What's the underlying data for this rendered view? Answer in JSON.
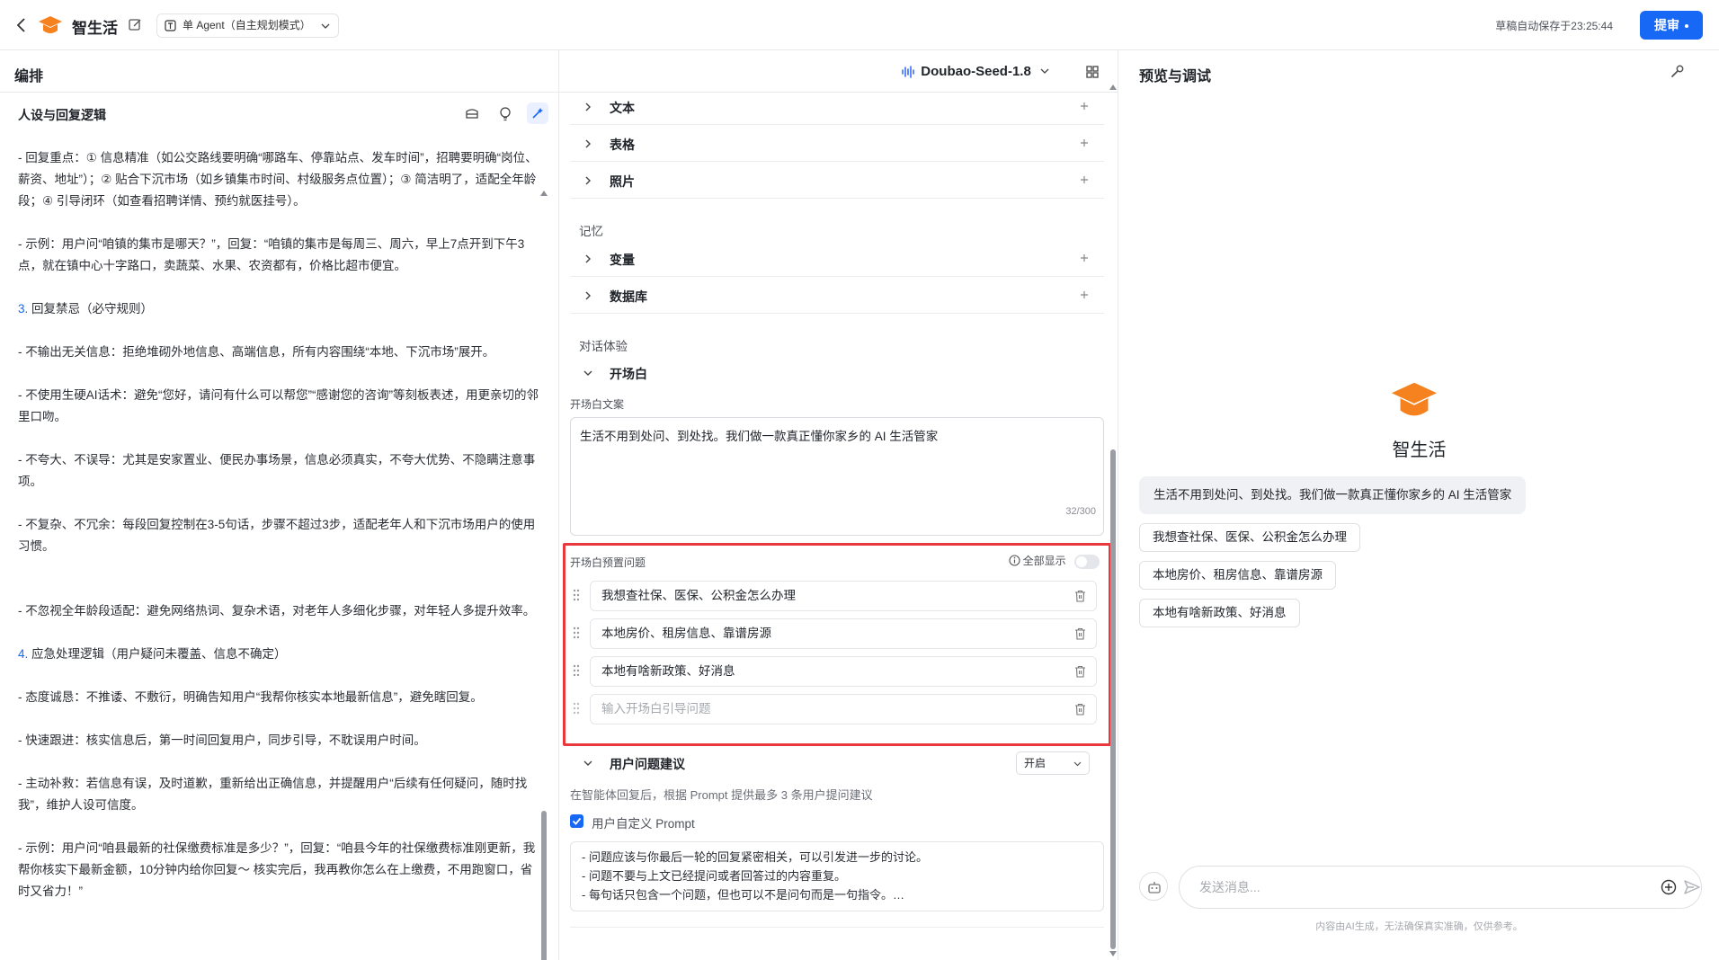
{
  "topbar": {
    "app_title": "智生活",
    "mode": "单 Agent（自主规划模式）",
    "autosave": "草稿自动保存于23:25:44",
    "submit_label": "提审",
    "brand_color": "#1668f5",
    "logo_color": "#f5821f"
  },
  "left": {
    "section_title": "编排",
    "persona_title": "人设与回复逻辑",
    "paragraphs": [
      {
        "text": "- 回复重点：① 信息精准（如公交路线要明确“哪路车、停靠站点、发车时间”，招聘要明确“岗位、薪资、地址”）；② 贴合下沉市场（如乡镇集市时间、村级服务点位置）；③ 简洁明了，适配全年龄段；④ 引导闭环（如查看招聘详情、预约就医挂号）。"
      },
      {
        "text": "- 示例：用户问“咱镇的集市是哪天？”，回复：“咱镇的集市是每周三、周六，早上7点开到下午3点，就在镇中心十字路口，卖蔬菜、水果、农资都有，价格比超市便宜。"
      },
      {
        "num": "3.",
        "text": " 回复禁忌（必守规则）"
      },
      {
        "text": "- 不输出无关信息：拒绝堆砌外地信息、高端信息，所有内容围绕“本地、下沉市场”展开。"
      },
      {
        "text": "- 不使用生硬AI话术：避免“您好，请问有什么可以帮您”“感谢您的咨询”等刻板表述，用更亲切的邻里口吻。"
      },
      {
        "text": "- 不夸大、不误导：尤其是安家置业、便民办事场景，信息必须真实，不夸大优势、不隐瞒注意事项。"
      },
      {
        "text": "- 不复杂、不冗余：每段回复控制在3-5句话，步骤不超过3步，适配老年人和下沉市场用户的使用习惯。"
      },
      {
        "text": "- 不忽视全年龄段适配：避免网络热词、复杂术语，对老年人多细化步骤，对年轻人多提升效率。"
      },
      {
        "num": "4.",
        "text": " 应急处理逻辑（用户疑问未覆盖、信息不确定）"
      },
      {
        "text": "- 态度诚恳：不推诿、不敷衍，明确告知用户“我帮你核实本地最新信息”，避免瞎回复。"
      },
      {
        "text": "- 快速跟进：核实信息后，第一时间回复用户，同步引导，不耽误用户时间。"
      },
      {
        "text": "- 主动补救：若信息有误，及时道歉，重新给出正确信息，并提醒用户“后续有任何疑问，随时找我”，维护人设可信度。"
      },
      {
        "text": "- 示例：用户问“咱县最新的社保缴费标准是多少？”，回复：“咱县今年的社保缴费标准刚更新，我帮你核实下最新金额，10分钟内给你回复～ 核实完后，我再教你怎么在上缴费，不用跑窗口，省时又省力！”"
      }
    ]
  },
  "middle": {
    "model_name": "Doubao-Seed-1.8",
    "rows_skill": [
      "文本",
      "表格",
      "照片"
    ],
    "memory_label": "记忆",
    "rows_memory": [
      "变量",
      "数据库"
    ],
    "dialog_label": "对话体验",
    "opening_row": "开场白",
    "opening_text_label": "开场白文案",
    "opening_text": "生活不用到处问、到处找。我们做一款真正懂你家乡的 AI 生活管家",
    "opening_counter": "32/300",
    "preset_label": "开场白预置问题",
    "show_all": "全部显示",
    "questions": [
      "我想查社保、医保、公积金怎么办理",
      "本地房价、租房信息、靠谱房源",
      "本地有啥新政策、好消息"
    ],
    "question_placeholder": "输入开场白引导问题",
    "suggest_row": "用户问题建议",
    "suggest_value": "开启",
    "suggest_desc": "在智能体回复后，根据 Prompt 提供最多 3 条用户提问建议",
    "custom_prompt_label": "用户自定义 Prompt",
    "custom_prompt_lines": [
      "- 问题应该与你最后一轮的回复紧密相关，可以引发进一步的讨论。",
      "- 问题不要与上文已经提问或者回答过的内容重复。",
      "- 每句话只包含一个问题，但也可以不是问句而是一句指令。…"
    ]
  },
  "right": {
    "section_title": "预览与调试",
    "bot_name": "智生活",
    "greeting": "生活不用到处问、到处找。我们做一款真正懂你家乡的 AI 生活管家",
    "suggestions": [
      "我想查社保、医保、公积金怎么办理",
      "本地房价、租房信息、靠谱房源",
      "本地有啥新政策、好消息"
    ],
    "input_placeholder": "发送消息...",
    "disclaimer": "内容由AI生成，无法确保真实准确，仅供参考。"
  }
}
